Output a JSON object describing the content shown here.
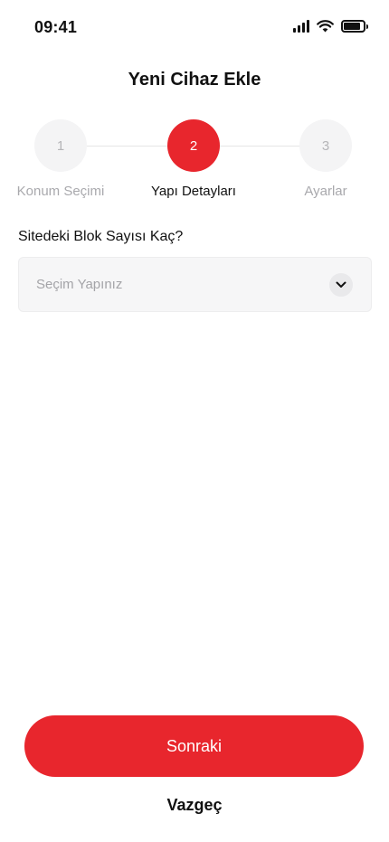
{
  "status_bar": {
    "time": "09:41",
    "icons": [
      "signal-icon",
      "wifi-icon",
      "battery-icon"
    ]
  },
  "header": {
    "title": "Yeni Cihaz Ekle"
  },
  "stepper": {
    "active_step": 2,
    "steps": [
      {
        "number": "1",
        "label": "Konum Seçimi"
      },
      {
        "number": "2",
        "label": "Yapı Detayları"
      },
      {
        "number": "3",
        "label": "Ayarlar"
      }
    ]
  },
  "form": {
    "question": "Sitedeki Blok Sayısı Kaç?",
    "select_placeholder": "Seçim Yapınız",
    "select_icon": "chevron-down-icon"
  },
  "actions": {
    "next_label": "Sonraki",
    "cancel_label": "Vazgeç"
  },
  "colors": {
    "accent": "#e8262d",
    "inactive_step": "#f4f4f5",
    "muted_text": "#a9a9ad"
  }
}
